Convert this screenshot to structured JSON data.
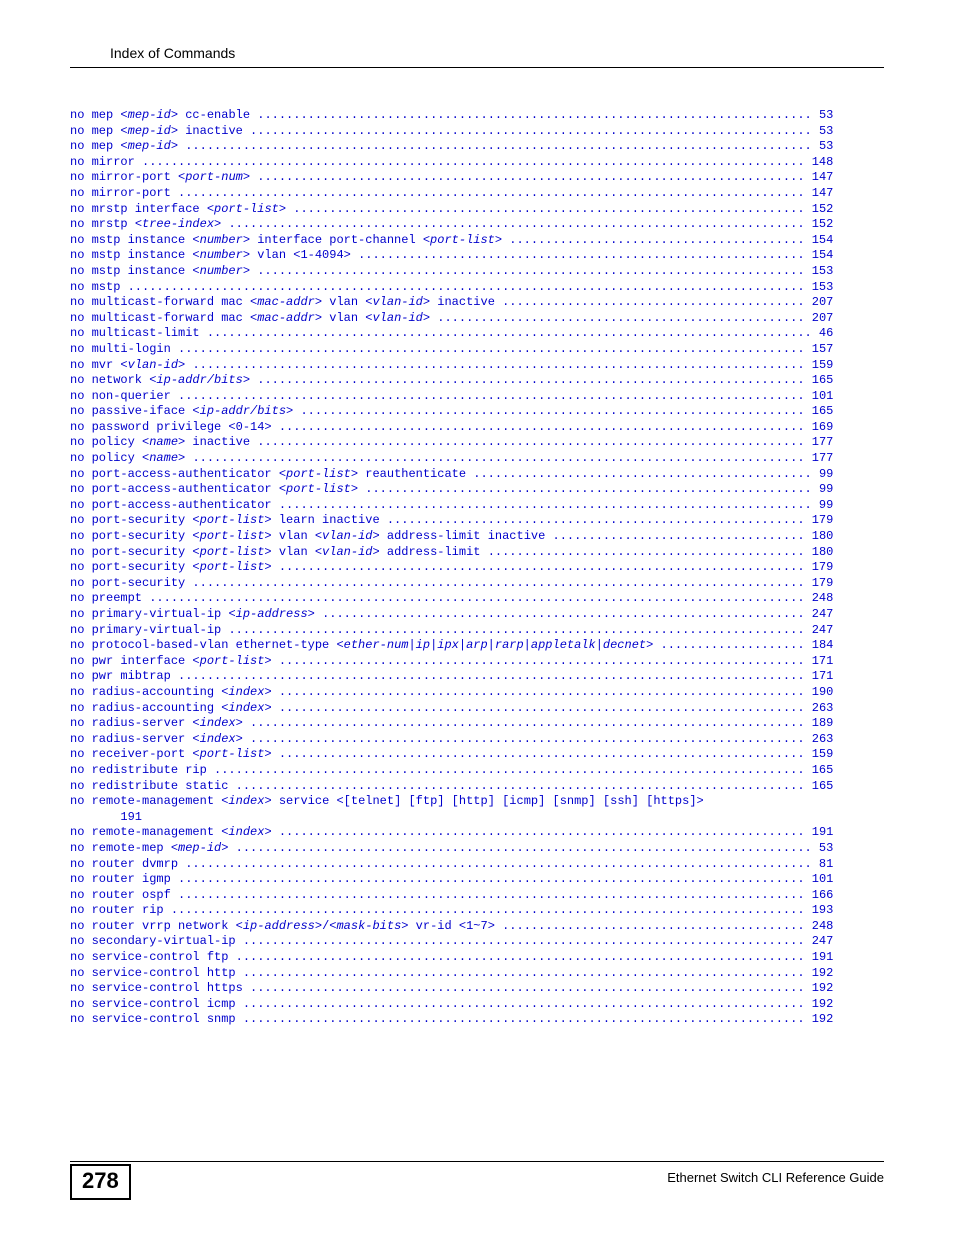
{
  "header": {
    "title": "Index of Commands"
  },
  "footer": {
    "page": "278",
    "text": "Ethernet Switch CLI Reference Guide"
  },
  "lines": [
    {
      "segs": [
        {
          "t": "no mep "
        },
        {
          "t": "<mep-id>",
          "i": true
        },
        {
          "t": " cc-enable "
        }
      ],
      "page": "53"
    },
    {
      "segs": [
        {
          "t": "no mep "
        },
        {
          "t": "<mep-id>",
          "i": true
        },
        {
          "t": " inactive "
        }
      ],
      "page": "53"
    },
    {
      "segs": [
        {
          "t": "no mep "
        },
        {
          "t": "<mep-id>",
          "i": true
        },
        {
          "t": " "
        }
      ],
      "page": "53"
    },
    {
      "segs": [
        {
          "t": "no mirror "
        }
      ],
      "page": "148"
    },
    {
      "segs": [
        {
          "t": "no mirror-port "
        },
        {
          "t": "<port-num>",
          "i": true
        },
        {
          "t": " "
        }
      ],
      "page": "147"
    },
    {
      "segs": [
        {
          "t": "no mirror-port "
        }
      ],
      "page": "147"
    },
    {
      "segs": [
        {
          "t": "no mrstp interface "
        },
        {
          "t": "<port-list>",
          "i": true
        },
        {
          "t": " "
        }
      ],
      "page": "152"
    },
    {
      "segs": [
        {
          "t": "no mrstp "
        },
        {
          "t": "<tree-index>",
          "i": true
        },
        {
          "t": " "
        }
      ],
      "page": "152"
    },
    {
      "segs": [
        {
          "t": "no mstp instance "
        },
        {
          "t": "<number>",
          "i": true
        },
        {
          "t": " interface port-channel "
        },
        {
          "t": "<port-list>",
          "i": true
        },
        {
          "t": " "
        }
      ],
      "page": "154"
    },
    {
      "segs": [
        {
          "t": "no mstp instance "
        },
        {
          "t": "<number>",
          "i": true
        },
        {
          "t": " vlan <1-4094> "
        }
      ],
      "page": "154"
    },
    {
      "segs": [
        {
          "t": "no mstp instance "
        },
        {
          "t": "<number>",
          "i": true
        },
        {
          "t": " "
        }
      ],
      "page": "153"
    },
    {
      "segs": [
        {
          "t": "no mstp "
        }
      ],
      "page": "153"
    },
    {
      "segs": [
        {
          "t": "no multicast-forward mac "
        },
        {
          "t": "<mac-addr>",
          "i": true
        },
        {
          "t": " vlan "
        },
        {
          "t": "<vlan-id>",
          "i": true
        },
        {
          "t": " inactive "
        }
      ],
      "page": "207"
    },
    {
      "segs": [
        {
          "t": "no multicast-forward mac "
        },
        {
          "t": "<mac-addr>",
          "i": true
        },
        {
          "t": " vlan "
        },
        {
          "t": "<vlan-id>",
          "i": true
        },
        {
          "t": " "
        }
      ],
      "page": "207"
    },
    {
      "segs": [
        {
          "t": "no multicast-limit "
        }
      ],
      "page": "46"
    },
    {
      "segs": [
        {
          "t": "no multi-login "
        }
      ],
      "page": "157"
    },
    {
      "segs": [
        {
          "t": "no mvr "
        },
        {
          "t": "<vlan-id>",
          "i": true
        },
        {
          "t": " "
        }
      ],
      "page": "159"
    },
    {
      "segs": [
        {
          "t": "no network "
        },
        {
          "t": "<ip-addr/bits>",
          "i": true
        },
        {
          "t": " "
        }
      ],
      "page": "165"
    },
    {
      "segs": [
        {
          "t": "no non-querier "
        }
      ],
      "page": "101"
    },
    {
      "segs": [
        {
          "t": "no passive-iface "
        },
        {
          "t": "<ip-addr/bits>",
          "i": true
        },
        {
          "t": " "
        }
      ],
      "page": "165"
    },
    {
      "segs": [
        {
          "t": "no password privilege <0-14> "
        }
      ],
      "page": "169"
    },
    {
      "segs": [
        {
          "t": "no policy "
        },
        {
          "t": "<name>",
          "i": true
        },
        {
          "t": " inactive "
        }
      ],
      "page": "177"
    },
    {
      "segs": [
        {
          "t": "no policy "
        },
        {
          "t": "<name>",
          "i": true
        },
        {
          "t": " "
        }
      ],
      "page": "177"
    },
    {
      "segs": [
        {
          "t": "no port-access-authenticator "
        },
        {
          "t": "<port-list>",
          "i": true
        },
        {
          "t": " reauthenticate "
        }
      ],
      "page": "99"
    },
    {
      "segs": [
        {
          "t": "no port-access-authenticator "
        },
        {
          "t": "<port-list>",
          "i": true
        },
        {
          "t": " "
        }
      ],
      "page": "99"
    },
    {
      "segs": [
        {
          "t": "no port-access-authenticator "
        }
      ],
      "page": "99"
    },
    {
      "segs": [
        {
          "t": "no port-security "
        },
        {
          "t": "<port-list>",
          "i": true
        },
        {
          "t": " learn inactive "
        }
      ],
      "page": "179"
    },
    {
      "segs": [
        {
          "t": "no port-security "
        },
        {
          "t": "<port-list>",
          "i": true
        },
        {
          "t": " vlan "
        },
        {
          "t": "<vlan-id>",
          "i": true
        },
        {
          "t": " address-limit inactive "
        }
      ],
      "page": "180"
    },
    {
      "segs": [
        {
          "t": "no port-security "
        },
        {
          "t": "<port-list>",
          "i": true
        },
        {
          "t": " vlan "
        },
        {
          "t": "<vlan-id>",
          "i": true
        },
        {
          "t": " address-limit "
        }
      ],
      "page": "180"
    },
    {
      "segs": [
        {
          "t": "no port-security "
        },
        {
          "t": "<port-list>",
          "i": true
        },
        {
          "t": " "
        }
      ],
      "page": "179"
    },
    {
      "segs": [
        {
          "t": "no port-security "
        }
      ],
      "page": "179"
    },
    {
      "segs": [
        {
          "t": "no preempt "
        }
      ],
      "page": "248"
    },
    {
      "segs": [
        {
          "t": "no primary-virtual-ip "
        },
        {
          "t": "<ip-address>",
          "i": true
        },
        {
          "t": " "
        }
      ],
      "page": "247"
    },
    {
      "segs": [
        {
          "t": "no primary-virtual-ip "
        }
      ],
      "page": "247"
    },
    {
      "segs": [
        {
          "t": "no protocol-based-vlan ethernet-type "
        },
        {
          "t": "<ether-num|ip|ipx|arp|rarp|appletalk|decnet>",
          "i": true
        },
        {
          "t": " "
        }
      ],
      "page": "184"
    },
    {
      "segs": [
        {
          "t": "no pwr interface "
        },
        {
          "t": "<port-list>",
          "i": true
        },
        {
          "t": " "
        }
      ],
      "page": "171"
    },
    {
      "segs": [
        {
          "t": "no pwr mibtrap "
        }
      ],
      "page": "171"
    },
    {
      "segs": [
        {
          "t": "no radius-accounting "
        },
        {
          "t": "<index>",
          "i": true
        },
        {
          "t": " "
        }
      ],
      "page": "190"
    },
    {
      "segs": [
        {
          "t": "no radius-accounting "
        },
        {
          "t": "<index>",
          "i": true
        },
        {
          "t": " "
        }
      ],
      "page": "263"
    },
    {
      "segs": [
        {
          "t": "no radius-server "
        },
        {
          "t": "<index>",
          "i": true
        },
        {
          "t": " "
        }
      ],
      "page": "189"
    },
    {
      "segs": [
        {
          "t": "no radius-server "
        },
        {
          "t": "<index>",
          "i": true
        },
        {
          "t": " "
        }
      ],
      "page": "263"
    },
    {
      "segs": [
        {
          "t": "no receiver-port "
        },
        {
          "t": "<port-list>",
          "i": true
        },
        {
          "t": " "
        }
      ],
      "page": "159"
    },
    {
      "segs": [
        {
          "t": "no redistribute rip "
        }
      ],
      "page": "165"
    },
    {
      "segs": [
        {
          "t": "no redistribute static "
        }
      ],
      "page": "165"
    },
    {
      "segs": [
        {
          "t": "no remote-management "
        },
        {
          "t": "<index>",
          "i": true
        },
        {
          "t": " service <[telnet] [ftp] [http] [icmp] [snmp] [ssh] [https]> "
        }
      ],
      "wrap": true,
      "wrap_page": "191"
    },
    {
      "segs": [
        {
          "t": "no remote-management "
        },
        {
          "t": "<index>",
          "i": true
        },
        {
          "t": " "
        }
      ],
      "page": "191"
    },
    {
      "segs": [
        {
          "t": "no remote-mep "
        },
        {
          "t": "<mep-id>",
          "i": true
        },
        {
          "t": " "
        }
      ],
      "page": "53"
    },
    {
      "segs": [
        {
          "t": "no router dvmrp "
        }
      ],
      "page": "81"
    },
    {
      "segs": [
        {
          "t": "no router igmp "
        }
      ],
      "page": "101"
    },
    {
      "segs": [
        {
          "t": "no router ospf "
        }
      ],
      "page": "166"
    },
    {
      "segs": [
        {
          "t": "no router rip "
        }
      ],
      "page": "193"
    },
    {
      "segs": [
        {
          "t": "no router vrrp network "
        },
        {
          "t": "<ip-address>",
          "i": true
        },
        {
          "t": "/"
        },
        {
          "t": "<mask-bits>",
          "i": true
        },
        {
          "t": " vr-id <1~7> "
        }
      ],
      "page": "248"
    },
    {
      "segs": [
        {
          "t": "no secondary-virtual-ip "
        }
      ],
      "page": "247"
    },
    {
      "segs": [
        {
          "t": "no service-control ftp "
        }
      ],
      "page": "191"
    },
    {
      "segs": [
        {
          "t": "no service-control http "
        }
      ],
      "page": "192"
    },
    {
      "segs": [
        {
          "t": "no service-control https "
        }
      ],
      "page": "192"
    },
    {
      "segs": [
        {
          "t": "no service-control icmp "
        }
      ],
      "page": "192"
    },
    {
      "segs": [
        {
          "t": "no service-control snmp "
        }
      ],
      "page": "192"
    }
  ]
}
